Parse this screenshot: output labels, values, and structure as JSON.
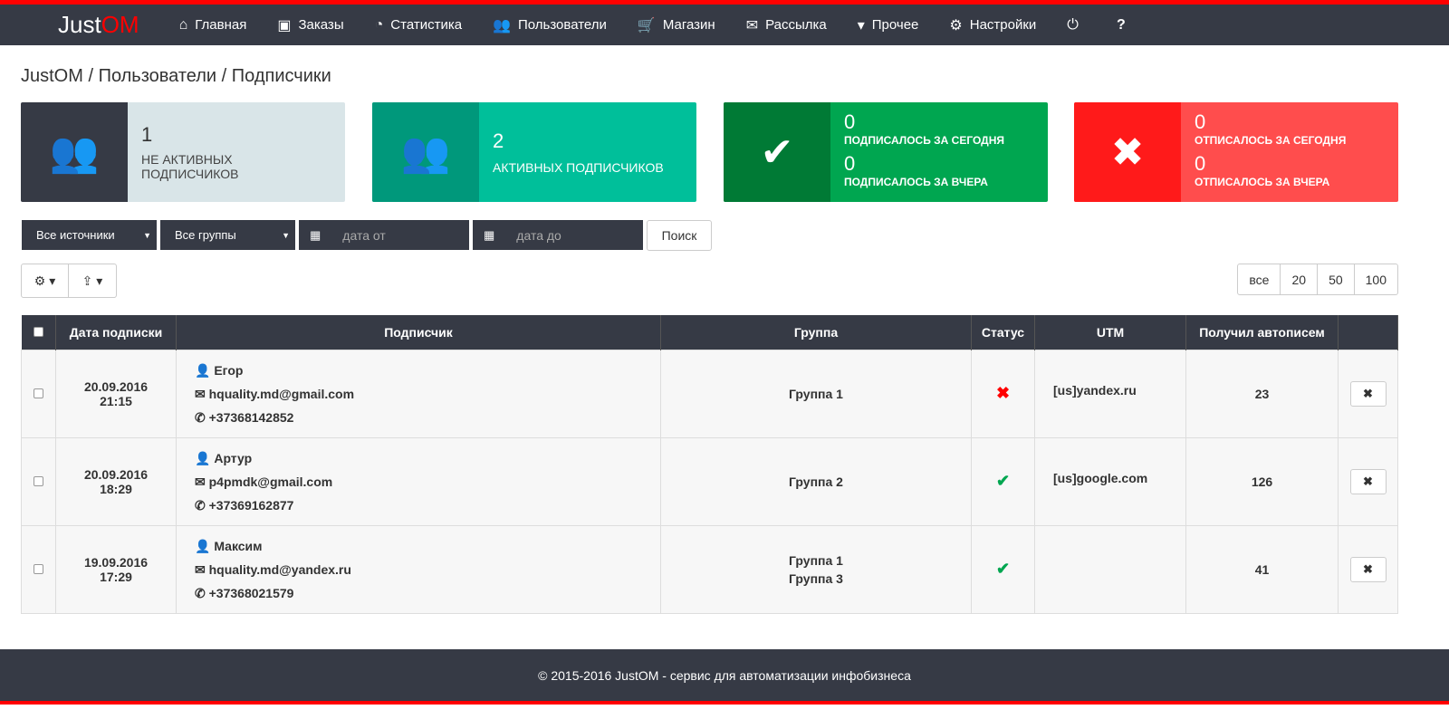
{
  "logo": {
    "a": "Just",
    "b": "OM"
  },
  "nav": [
    {
      "icon": "⌂",
      "label": "Главная",
      "name": "home"
    },
    {
      "icon": "▣",
      "label": "Заказы",
      "name": "orders"
    },
    {
      "icon": "◔",
      "label": "Статистика",
      "name": "stats"
    },
    {
      "icon": "👥",
      "label": "Пользователи",
      "name": "users"
    },
    {
      "icon": "🛒",
      "label": "Магазин",
      "name": "shop"
    },
    {
      "icon": "✉",
      "label": "Рассылка",
      "name": "mailing"
    },
    {
      "icon": "▾",
      "label": "Прочее",
      "name": "other"
    },
    {
      "icon": "⚙",
      "label": "Настройки",
      "name": "settings"
    }
  ],
  "breadcrumb": "JustOM / Пользователи / Подписчики",
  "cards": {
    "inactive": {
      "count": "1",
      "label": "НЕ АКТИВНЫХ ПОДПИСЧИКОВ"
    },
    "active": {
      "count": "2",
      "label": "АКТИВНЫХ ПОДПИСЧИКОВ"
    },
    "subscribed": {
      "today": "0",
      "today_label": "ПОДПИСАЛОСЬ ЗА СЕГОДНЯ",
      "yesterday": "0",
      "yesterday_label": "ПОДПИСАЛОСЬ ЗА ВЧЕРА"
    },
    "unsubscribed": {
      "today": "0",
      "today_label": "ОТПИСАЛОСЬ ЗА СЕГОДНЯ",
      "yesterday": "0",
      "yesterday_label": "ОТПИСАЛОСЬ ЗА ВЧЕРА"
    }
  },
  "filters": {
    "source": "Все источники",
    "group": "Все группы",
    "date_from": "дата от",
    "date_to": "дата до",
    "search": "Поиск"
  },
  "pagination": [
    "все",
    "20",
    "50",
    "100"
  ],
  "table": {
    "headers": [
      "Дата подписки",
      "Подписчик",
      "Группа",
      "Статус",
      "UTM",
      "Получил автописем"
    ],
    "rows": [
      {
        "date": "20.09.2016",
        "time": "21:15",
        "name": "Егор",
        "email": "hquality.md@gmail.com",
        "phone": "+37368142852",
        "groups": [
          "Группа 1"
        ],
        "status": "inactive",
        "utm": "[us]yandex.ru",
        "count": "23"
      },
      {
        "date": "20.09.2016",
        "time": "18:29",
        "name": "Артур",
        "email": "p4pmdk@gmail.com",
        "phone": "+37369162877",
        "groups": [
          "Группа 2"
        ],
        "status": "active",
        "utm": "[us]google.com",
        "count": "126"
      },
      {
        "date": "19.09.2016",
        "time": "17:29",
        "name": "Максим",
        "email": "hquality.md@yandex.ru",
        "phone": "+37368021579",
        "groups": [
          "Группа 1",
          "Группа 3"
        ],
        "status": "active",
        "utm": "",
        "count": "41"
      }
    ]
  },
  "footer": "© 2015-2016 JustOM - сервис для автоматизации инфобизнеса",
  "colors": {
    "dark": "#363a45",
    "red": "#ff0000",
    "teal": "#00bf9a",
    "green": "#00a650"
  }
}
